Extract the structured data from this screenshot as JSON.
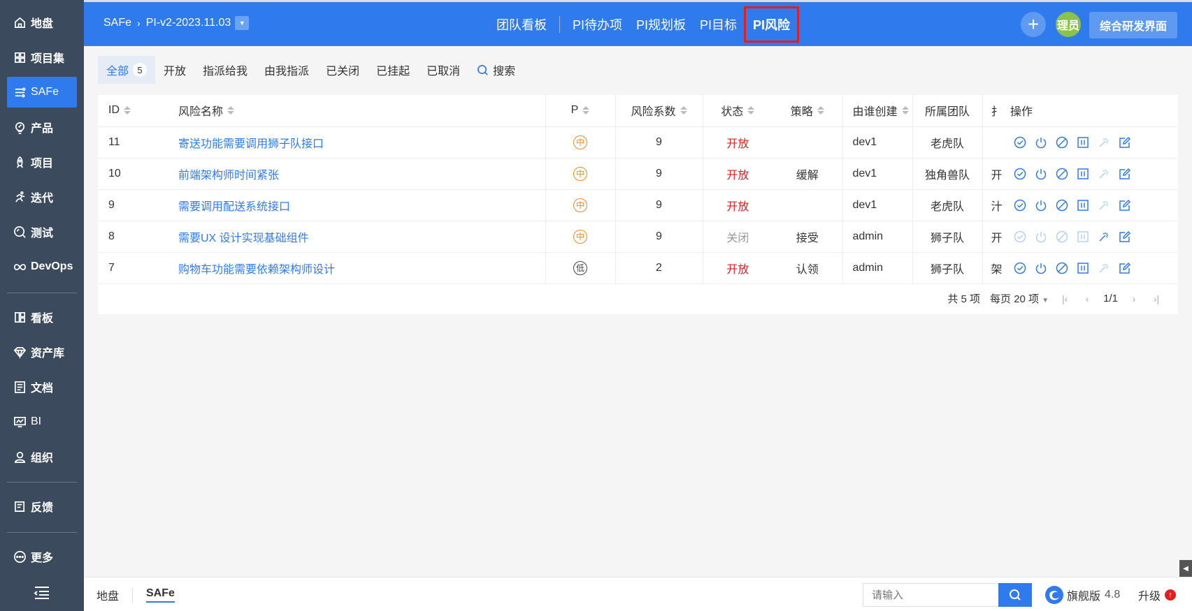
{
  "sidebar": {
    "items": [
      {
        "label": "地盘",
        "icon": "home-icon"
      },
      {
        "label": "项目集",
        "icon": "grid-icon"
      },
      {
        "label": "SAFe",
        "icon": "safe-icon"
      },
      {
        "label": "产品",
        "icon": "lightbulb-icon"
      },
      {
        "label": "项目",
        "icon": "rocket-icon"
      },
      {
        "label": "迭代",
        "icon": "running-icon"
      },
      {
        "label": "测试",
        "icon": "bug-search-icon"
      },
      {
        "label": "DevOps",
        "icon": "infinity-icon"
      },
      {
        "label": "看板",
        "icon": "kanban-icon"
      },
      {
        "label": "资产库",
        "icon": "diamond-icon"
      },
      {
        "label": "文档",
        "icon": "document-icon"
      },
      {
        "label": "BI",
        "icon": "monitor-chart-icon"
      },
      {
        "label": "组织",
        "icon": "user-icon"
      },
      {
        "label": "反馈",
        "icon": "feedback-icon"
      },
      {
        "label": "更多",
        "icon": "more-icon"
      }
    ],
    "active": "SAFe"
  },
  "topbar": {
    "breadcrumb": {
      "root": "SAFe",
      "current": "PI-v2-2023.11.03"
    },
    "nav": [
      "团队看板",
      "PI待办项",
      "PI规划板",
      "PI目标",
      "PI风险"
    ],
    "active_nav": "PI风险",
    "avatar_text": "理员",
    "dev_button": "综合研发界面"
  },
  "filters": {
    "tabs": [
      "全部",
      "开放",
      "指派给我",
      "由我指派",
      "已关闭",
      "已挂起",
      "已取消"
    ],
    "all_count": "5",
    "search_label": "搜索"
  },
  "table": {
    "headers": {
      "id": "ID",
      "name": "风险名称",
      "p": "P",
      "factor": "风险系数",
      "status": "状态",
      "strategy": "策略",
      "creator": "由谁创建",
      "team": "所属团队",
      "assignee": "扌",
      "actions": "操作"
    },
    "rows": [
      {
        "id": "11",
        "name": "寄送功能需要调用狮子队接口",
        "p": "中",
        "p_level": "mid",
        "factor": "9",
        "status": "开放",
        "status_type": "open",
        "strategy": "",
        "creator": "dev1",
        "team": "老虎队",
        "assignee": "",
        "disabled": false
      },
      {
        "id": "10",
        "name": "前端架构师时间紧张",
        "p": "中",
        "p_level": "mid",
        "factor": "9",
        "status": "开放",
        "status_type": "open",
        "strategy": "缓解",
        "creator": "dev1",
        "team": "独角兽队",
        "assignee": "开",
        "disabled": false
      },
      {
        "id": "9",
        "name": "需要调用配送系统接口",
        "p": "中",
        "p_level": "mid",
        "factor": "9",
        "status": "开放",
        "status_type": "open",
        "strategy": "",
        "creator": "dev1",
        "team": "老虎队",
        "assignee": "汁",
        "disabled": false
      },
      {
        "id": "8",
        "name": "需要UX 设计实现基础组件",
        "p": "中",
        "p_level": "mid",
        "factor": "9",
        "status": "关闭",
        "status_type": "closed",
        "strategy": "接受",
        "creator": "admin",
        "team": "狮子队",
        "assignee": "开",
        "disabled": true
      },
      {
        "id": "7",
        "name": "购物车功能需要依赖架构师设计",
        "p": "低",
        "p_level": "low",
        "factor": "2",
        "status": "开放",
        "status_type": "open",
        "strategy": "认领",
        "creator": "admin",
        "team": "狮子队",
        "assignee": "架",
        "disabled": false
      }
    ]
  },
  "pager": {
    "total": "共 5 项",
    "per_page": "每页 20 项",
    "page": "1/1"
  },
  "bottombar": {
    "tabs": [
      "地盘",
      "SAFe"
    ],
    "active_tab": "SAFe",
    "search_placeholder": "请输入",
    "brand": "旗舰版",
    "version": "4.8",
    "upgrade": "升级"
  },
  "colors": {
    "primary": "#2f7bee",
    "sidebar": "#3c4a5e",
    "danger": "#e02020",
    "medium_priority": "#f08a24"
  }
}
